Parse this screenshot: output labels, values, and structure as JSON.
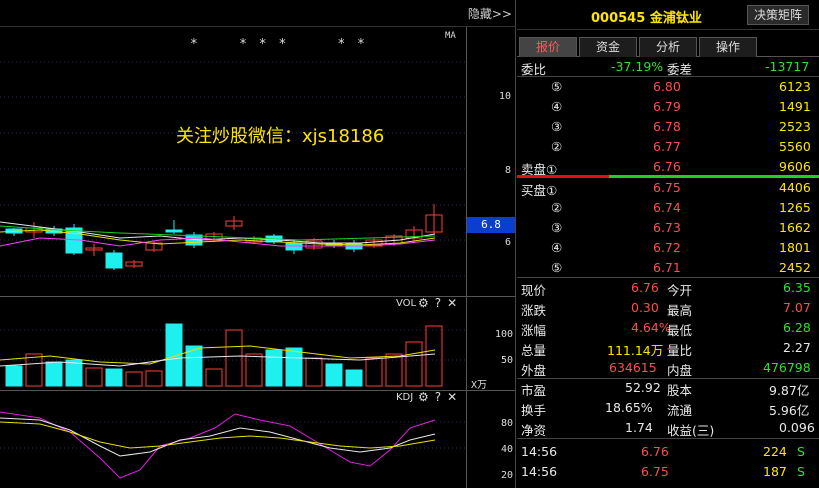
{
  "chart": {
    "hide_label": "隐藏>>",
    "promo_text": "关注炒股微信：xjs18186",
    "star_marks": "*    * * *     * *",
    "ma_label": "MA",
    "price_axis": [
      "10",
      "8",
      "6"
    ],
    "current_price_tag": "6.8",
    "vol_label": "VOL",
    "vol_axis": [
      "100",
      "50"
    ],
    "vol_unit": "X万",
    "kdj_label": "KDJ",
    "kdj_axis": [
      "80",
      "40",
      "20"
    ],
    "gear_icon": "⚙",
    "help_icon": "?",
    "close_icon": "✕"
  },
  "side": {
    "stock_code": "000545",
    "stock_name": "金浦钛业",
    "decision_button": "决策矩阵",
    "tabs": [
      "报价",
      "资金",
      "分析",
      "操作"
    ],
    "wei": {
      "label1": "委比",
      "value1": "-37.19%",
      "label2": "委差",
      "value2": "-13717"
    },
    "sell": [
      {
        "label": "⑤",
        "price": "6.80",
        "vol": "6123"
      },
      {
        "label": "④",
        "price": "6.79",
        "vol": "1491"
      },
      {
        "label": "③",
        "price": "6.78",
        "vol": "2523"
      },
      {
        "label": "②",
        "price": "6.77",
        "vol": "5560"
      },
      {
        "label": "卖盘①",
        "price": "6.76",
        "vol": "9606"
      }
    ],
    "buy": [
      {
        "label": "买盘①",
        "price": "6.75",
        "vol": "4406"
      },
      {
        "label": "②",
        "price": "6.74",
        "vol": "1265"
      },
      {
        "label": "③",
        "price": "6.73",
        "vol": "1662"
      },
      {
        "label": "④",
        "price": "6.72",
        "vol": "1801"
      },
      {
        "label": "⑤",
        "price": "6.71",
        "vol": "2452"
      }
    ],
    "stats": [
      {
        "l1": "现价",
        "v1": "6.76",
        "l2": "今开",
        "v2": "6.35"
      },
      {
        "l1": "涨跌",
        "v1": "0.30",
        "l2": "最高",
        "v2": "7.07"
      },
      {
        "l1": "涨幅",
        "v1": "4.64%",
        "l2": "最低",
        "v2": "6.28"
      },
      {
        "l1": "总量",
        "v1": "111.14万",
        "l2": "量比",
        "v2": "2.27"
      },
      {
        "l1": "外盘",
        "v1": "634615",
        "l2": "内盘",
        "v2": "476798"
      }
    ],
    "stats2": [
      {
        "l1": "市盈",
        "v1": "52.92",
        "l2": "股本",
        "v2": "9.87亿"
      },
      {
        "l1": "换手",
        "v1": "18.65%",
        "l2": "流通",
        "v2": "5.96亿"
      },
      {
        "l1": "净资",
        "v1": "1.74",
        "l2": "收益(三)",
        "v2": "0.096"
      }
    ],
    "ticks": [
      {
        "time": "14:56",
        "price": "6.76",
        "vol": "224",
        "side": "S"
      },
      {
        "time": "14:56",
        "price": "6.75",
        "vol": "187",
        "side": "S"
      }
    ]
  }
}
